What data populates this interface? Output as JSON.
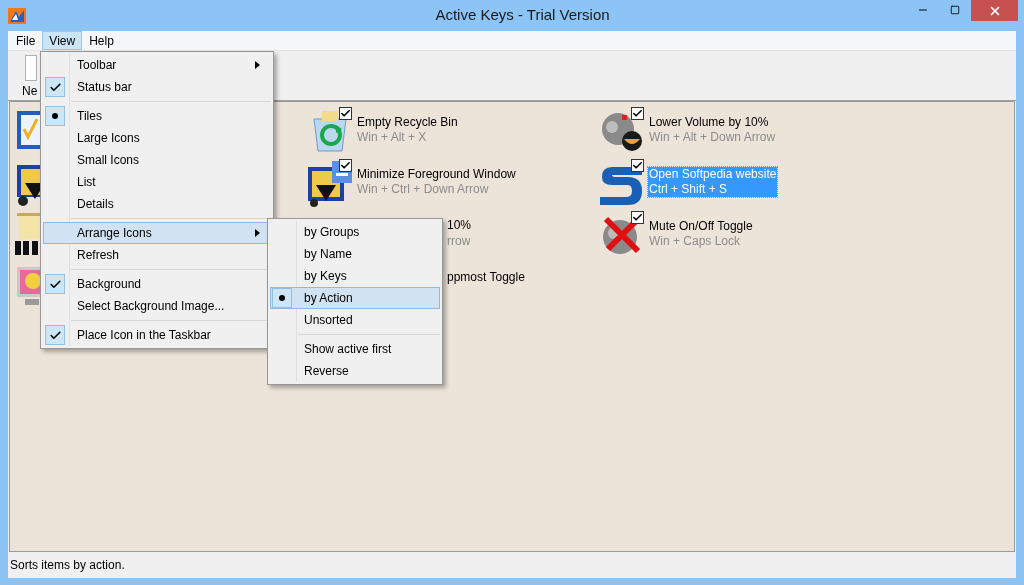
{
  "window": {
    "title": "Active Keys - Trial Version"
  },
  "menubar": [
    {
      "label": "File",
      "selected": false
    },
    {
      "label": "View",
      "selected": true
    },
    {
      "label": "Help",
      "selected": false
    }
  ],
  "toolbar": [
    {
      "label": "Ne"
    }
  ],
  "tiles": [
    {
      "kind": "icon_only"
    },
    {
      "kind": "full",
      "name": "Empty Recycle Bin",
      "keys": "Win + Alt + X",
      "checked": true,
      "selected": false
    },
    {
      "kind": "full",
      "name": "Lower Volume by 10%",
      "keys": "Win + Alt + Down Arrow",
      "checked": true,
      "selected": false
    },
    {
      "kind": "icon_only"
    },
    {
      "kind": "full",
      "name": "Minimize Foreground Window",
      "keys": "Win + Ctrl + Down Arrow",
      "checked": true,
      "selected": false
    },
    {
      "kind": "full",
      "name": "Open Softpedia website",
      "keys": "Ctrl + Shift + S",
      "checked": true,
      "selected": true
    },
    {
      "kind": "icon_only"
    },
    {
      "kind": "partial",
      "name": "10%",
      "keys": "rrow"
    },
    {
      "kind": "full",
      "name": "Mute On/Off Toggle",
      "keys": "Win + Caps Lock",
      "checked": true,
      "selected": false
    },
    {
      "kind": "icon_only"
    },
    {
      "kind": "partial",
      "name": "ppmost Toggle"
    }
  ],
  "view_menu": [
    {
      "kind": "submenu",
      "label": "Toolbar",
      "highlighted": false
    },
    {
      "kind": "check",
      "label": "Status bar",
      "checked": true,
      "highlighted": false
    },
    {
      "kind": "separator"
    },
    {
      "kind": "radio",
      "label": "Tiles",
      "checked": true,
      "highlighted": false
    },
    {
      "kind": "radio",
      "label": "Large Icons",
      "checked": false,
      "highlighted": false
    },
    {
      "kind": "radio",
      "label": "Small Icons",
      "checked": false,
      "highlighted": false
    },
    {
      "kind": "radio",
      "label": "List",
      "checked": false,
      "highlighted": false
    },
    {
      "kind": "radio",
      "label": "Details",
      "checked": false,
      "highlighted": false
    },
    {
      "kind": "separator"
    },
    {
      "kind": "submenu",
      "label": "Arrange Icons",
      "highlighted": true
    },
    {
      "kind": "command",
      "label": "Refresh",
      "highlighted": false
    },
    {
      "kind": "separator"
    },
    {
      "kind": "check",
      "label": "Background",
      "checked": true,
      "highlighted": false
    },
    {
      "kind": "command",
      "label": "Select Background Image...",
      "highlighted": false
    },
    {
      "kind": "separator"
    },
    {
      "kind": "check",
      "label": "Place Icon in the Taskbar",
      "checked": true,
      "highlighted": false
    }
  ],
  "arrange_menu": [
    {
      "kind": "radio",
      "label": "by Groups",
      "checked": false,
      "highlighted": false
    },
    {
      "kind": "radio",
      "label": "by Name",
      "checked": false,
      "highlighted": false
    },
    {
      "kind": "radio",
      "label": "by Keys",
      "checked": false,
      "highlighted": false
    },
    {
      "kind": "radio",
      "label": "by Action",
      "checked": true,
      "highlighted": true
    },
    {
      "kind": "radio",
      "label": "Unsorted",
      "checked": false,
      "highlighted": false
    },
    {
      "kind": "separator"
    },
    {
      "kind": "check",
      "label": "Show active first",
      "checked": false,
      "highlighted": false
    },
    {
      "kind": "check",
      "label": "Reverse",
      "checked": false,
      "highlighted": false
    }
  ],
  "status_bar": "Sorts items by action."
}
